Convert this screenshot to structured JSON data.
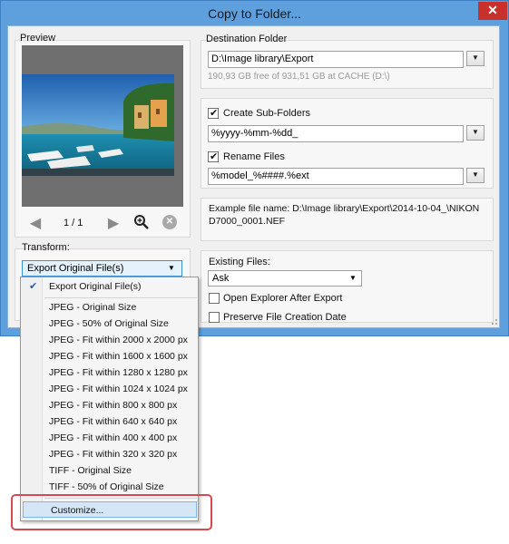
{
  "window": {
    "title": "Copy to Folder..."
  },
  "preview": {
    "label": "Preview",
    "page_indicator": "1 / 1"
  },
  "transform": {
    "label": "Transform:",
    "selected": "Export Original File(s)",
    "options": [
      "Export Original File(s)",
      "JPEG - Original Size",
      "JPEG - 50% of Original Size",
      "JPEG - Fit within 2000 x 2000 px",
      "JPEG - Fit within 1600 x 1600 px",
      "JPEG - Fit within 1280 x 1280 px",
      "JPEG - Fit within 1024 x 1024 px",
      "JPEG - Fit within 800 x 800 px",
      "JPEG - Fit within 640 x 640 px",
      "JPEG - Fit within 400 x 400 px",
      "JPEG - Fit within 320 x 320 px",
      "TIFF - Original Size",
      "TIFF - 50% of Original Size",
      "Customize..."
    ]
  },
  "destination": {
    "label": "Destination Folder",
    "path": "D:\\Image library\\Export",
    "free_space": "190,93 GB free of 931,51 GB at CACHE (D:\\)"
  },
  "subfolders": {
    "label": "Create Sub-Folders",
    "checked": true,
    "pattern": "%yyyy-%mm-%dd_"
  },
  "rename": {
    "label": "Rename Files",
    "checked": true,
    "pattern": "%model_%####.%ext"
  },
  "example": {
    "line1": "Example file name: D:\\Image library\\Export\\2014-10-04_\\NIKON",
    "line2": "D7000_0001.NEF"
  },
  "existing": {
    "label": "Existing Files:",
    "value": "Ask"
  },
  "options": {
    "open_explorer": {
      "label": "Open Explorer After Export",
      "checked": false
    },
    "preserve_date": {
      "label": "Preserve File Creation Date",
      "checked": false
    }
  }
}
